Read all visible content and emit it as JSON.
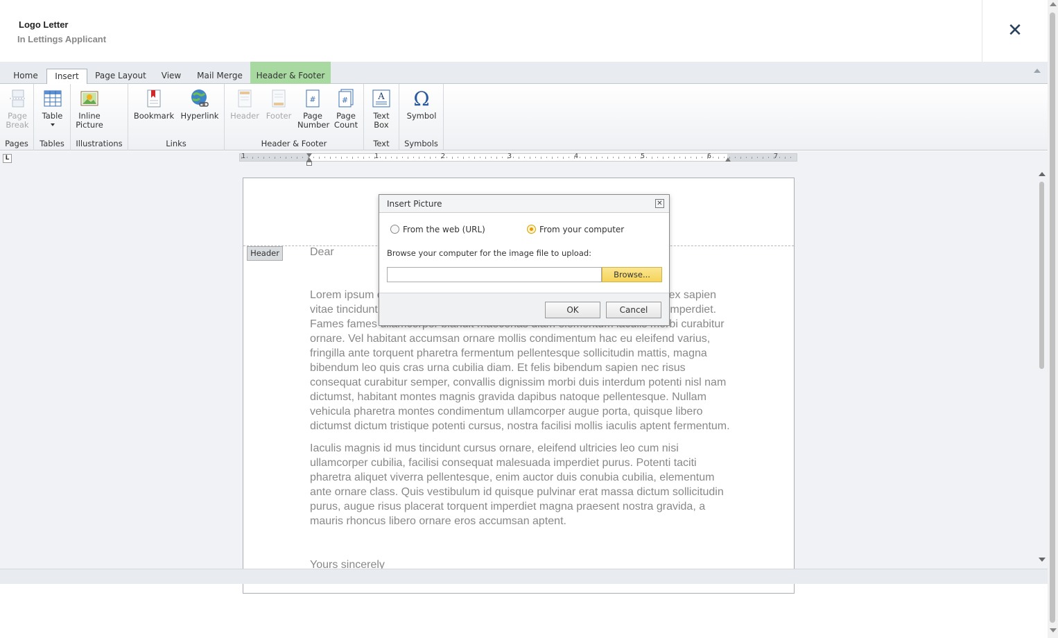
{
  "window": {
    "title": "Logo Letter",
    "subtitle": "In Lettings Applicant",
    "close_label": "✕"
  },
  "ribbon": {
    "tabs": [
      {
        "label": "Home"
      },
      {
        "label": "Insert"
      },
      {
        "label": "Page Layout"
      },
      {
        "label": "View"
      },
      {
        "label": "Mail Merge"
      },
      {
        "label": "Header & Footer"
      }
    ],
    "active_tab": "Insert",
    "groups": {
      "pages": {
        "label": "Pages",
        "page_break": "Page Break"
      },
      "tables": {
        "label": "Tables",
        "table": "Table"
      },
      "illustrations": {
        "label": "Illustrations",
        "inline_picture": "Inline Picture"
      },
      "links": {
        "label": "Links",
        "bookmark": "Bookmark",
        "hyperlink": "Hyperlink"
      },
      "header_footer": {
        "label": "Header & Footer",
        "header": "Header",
        "footer": "Footer",
        "page_number": "Page Number",
        "page_count": "Page Count"
      },
      "text": {
        "label": "Text",
        "text_box": "Text Box"
      },
      "symbols": {
        "label": "Symbols",
        "symbol": "Symbol"
      }
    },
    "accent_color": "#a8d9a0"
  },
  "ruler": {
    "numbers": [
      "1",
      "1",
      "2",
      "3",
      "4",
      "5",
      "6",
      "7"
    ],
    "tab_selector": "L"
  },
  "document": {
    "header_tag": "Header",
    "greeting": "Dear",
    "paragraph1": "Lorem ipsum dolor sit amet consectetur adipiscing elit. Quisque faucibus ex sapien vitae tincidunt taciti integer aliquam. Porttitor nibh at curabitur consequat imperdiet. Fames fames ullamcorper blandit maecenas diam elementum iaculis morbi curabitur ornare. Vel habitant accumsan ornare mollis condimentum hac eu eleifend varius, fringilla ante torquent pharetra fermentum pellentesque sollicitudin mattis, magna bibendum leo quis cras urna cubilia diam. Et felis bibendum sapien nec risus consequat curabitur semper, convallis dignissim morbi duis interdum potenti nisl nam dictumst, habitant montes magnis gravida dapibus natoque pellentesque. Nullam vehicula pharetra montes condimentum ullamcorper augue porta, quisque libero dictumst dictum tristique potenti cursus, nostra facilisi mollis iaculis aptent fermentum.",
    "paragraph2": "Iaculis magnis id mus tincidunt cursus ornare, eleifend ultricies leo cum nisi ullamcorper cubilia, facilisi consequat malesuada imperdiet purus. Potenti taciti pharetra aliquet viverra pellentesque, enim auctor duis conubia cubilia, elementum ante ornare class. Quis vestibulum id quisque pulvinar erat massa dictum sollicitudin purus, augue risus placerat torquent imperdiet magna praesent nostra gravida, a mauris rhoncus libero ornare eros accumsan aptent.",
    "closing": "Yours sincerely"
  },
  "dialog": {
    "title": "Insert Picture",
    "option_web": "From the web (URL)",
    "option_computer": "From your computer",
    "selected_option": "From your computer",
    "browse_label": "Browse your computer for the image file to upload:",
    "file_value": "",
    "browse_button": "Browse...",
    "ok_button": "OK",
    "cancel_button": "Cancel"
  }
}
